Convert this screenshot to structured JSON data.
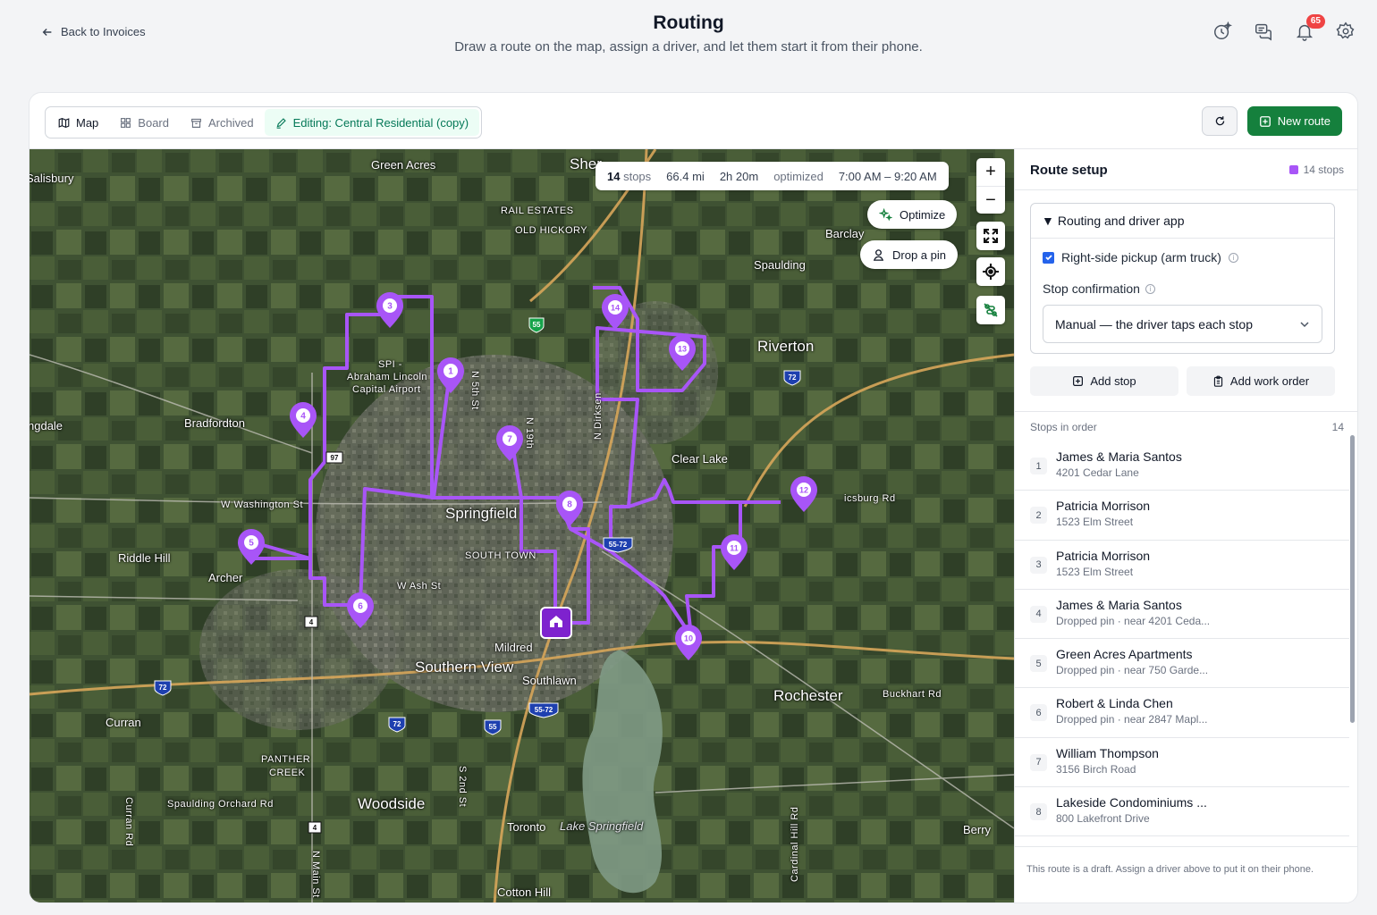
{
  "header": {
    "back_label": "Back to Invoices",
    "title": "Routing",
    "subtitle": "Draw a route on the map, assign a driver, and let them start it from their phone.",
    "notification_count": "65"
  },
  "toolbar": {
    "tabs": [
      {
        "label": "Map"
      },
      {
        "label": "Board"
      },
      {
        "label": "Archived"
      },
      {
        "label": "Editing: Central Residential (copy)"
      }
    ],
    "new_route_label": "New route"
  },
  "map": {
    "summary": {
      "stops_value": "14",
      "stops_unit": "stops",
      "distance": "66.4 mi",
      "duration": "2h 20m",
      "status": "optimized",
      "time_window": "7:00 AM – 9:20 AM"
    },
    "optimize_label": "Optimize",
    "drop_pin_label": "Drop a pin",
    "places": [
      "Salisbury",
      "Green Acres",
      "Sher",
      "RAIL ESTATES",
      "OLD HICKORY",
      "Barclay",
      "Spaulding",
      "Riverton",
      "Bradfordton",
      "ngdale",
      "Clear Lake",
      "W Washington St",
      "Springfield",
      "SOUTH TOWN",
      "Riddle Hill",
      "Archer",
      "W Ash St",
      "Mildred",
      "Southern View",
      "Southlawn",
      "Rochester",
      "Buckhart Rd",
      "Curran",
      "PANTHER",
      "CREEK",
      "Spaulding Orchard Rd",
      "Woodside",
      "Toronto",
      "Lake Springfield",
      "Berry",
      "Cotton Hill",
      "SPI -",
      "Abraham Lincoln",
      "Capital Airport",
      "icsburg Rd",
      "N 5th St",
      "N 19th",
      "N Dirksen",
      "S 2nd St",
      "N Main St",
      "Curran Rd",
      "Cardinal Hill Rd"
    ],
    "shields": [
      "55",
      "72",
      "97",
      "55-72",
      "4",
      "72",
      "72",
      "55",
      "55-72",
      "4"
    ]
  },
  "sidebar": {
    "title": "Route setup",
    "stop_count": "14 stops",
    "settings_title": "Routing and driver app",
    "right_side_pickup": "Right-side pickup (arm truck)",
    "stop_confirmation_label": "Stop confirmation",
    "stop_confirmation_value": "Manual — the driver taps each stop",
    "add_stop_label": "Add stop",
    "add_work_order_label": "Add work order",
    "stops_in_order_label": "Stops in order",
    "stops_in_order_count": "14",
    "stops": [
      {
        "num": "1",
        "name": "James & Maria Santos",
        "address": "4201 Cedar Lane"
      },
      {
        "num": "2",
        "name": "Patricia Morrison",
        "address": "1523 Elm Street"
      },
      {
        "num": "3",
        "name": "Patricia Morrison",
        "address": "1523 Elm Street"
      },
      {
        "num": "4",
        "name": "James & Maria Santos",
        "address": "Dropped pin · near 4201 Ceda..."
      },
      {
        "num": "5",
        "name": "Green Acres Apartments",
        "address": "Dropped pin · near 750 Garde..."
      },
      {
        "num": "6",
        "name": "Robert & Linda Chen",
        "address": "Dropped pin · near 2847 Mapl..."
      },
      {
        "num": "7",
        "name": "William Thompson",
        "address": "3156 Birch Road"
      },
      {
        "num": "8",
        "name": "Lakeside Condominiums ...",
        "address": "800 Lakefront Drive"
      }
    ],
    "footer_note": "This route is a draft. Assign a driver above to put it on their phone."
  },
  "colors": {
    "route": "#a855f7",
    "primary_green": "#15803d",
    "badge_red": "#ef4444"
  }
}
